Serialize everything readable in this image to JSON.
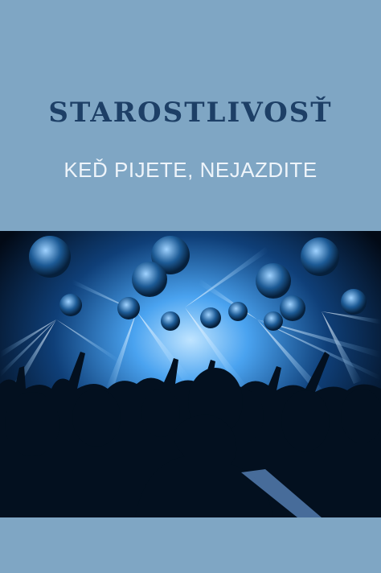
{
  "poster": {
    "title": "STAROSTLIVOSŤ",
    "subtitle": "KEĎ PIJETE, NEJAZDITE",
    "background_color": "#7fa6c4",
    "title_color": "#1d3f66",
    "subtitle_color": "#eef4fa"
  },
  "photo": {
    "subject": "concert-crowd-with-blue-laser-lights",
    "dominant_color": "#3a8fd8"
  }
}
